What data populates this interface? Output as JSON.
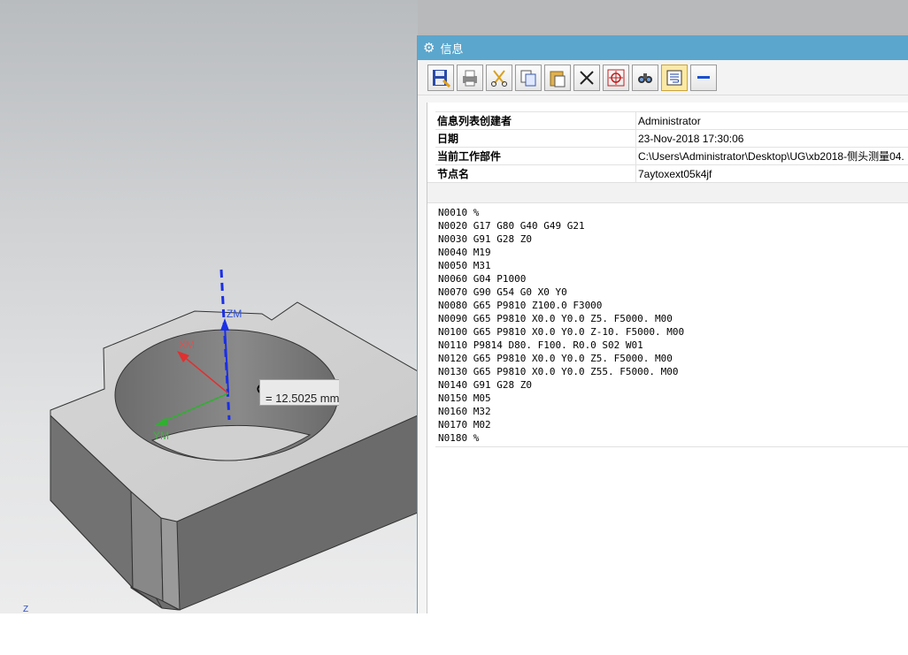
{
  "viewport": {
    "measurement": "= 12.5025 mm",
    "axes": {
      "z": "ZM",
      "x": "XM",
      "y": "YM",
      "corner": "Z"
    }
  },
  "window": {
    "title": "信息",
    "toolbar": [
      {
        "name": "save-icon"
      },
      {
        "name": "print-icon"
      },
      {
        "name": "cut-icon"
      },
      {
        "name": "copy-icon"
      },
      {
        "name": "paste-icon"
      },
      {
        "name": "delete-icon"
      },
      {
        "name": "target-icon"
      },
      {
        "name": "find-icon"
      },
      {
        "name": "word-wrap-icon",
        "active": true
      },
      {
        "name": "minimize-icon"
      }
    ],
    "header": [
      {
        "key": "信息列表创建者",
        "value": "Administrator"
      },
      {
        "key": "日期",
        "value": "23-Nov-2018 17:30:06"
      },
      {
        "key": "当前工作部件",
        "value": "C:\\Users\\Administrator\\Desktop\\UG\\xb2018-侧头测量04."
      },
      {
        "key": "节点名",
        "value": "7aytoxext05k4jf"
      }
    ],
    "gcode": [
      "N0010 %",
      "N0020 G17 G80 G40 G49 G21",
      "N0030 G91 G28 Z0",
      "N0040 M19",
      "N0050 M31",
      "N0060 G04 P1000",
      "N0070 G90 G54 G0 X0 Y0",
      "N0080 G65 P9810 Z100.0 F3000",
      "N0090 G65 P9810 X0.0 Y0.0 Z5. F5000. M00",
      "N0100 G65 P9810 X0.0 Y0.0 Z-10. F5000. M00",
      "N0110 P9814 D80. F100. R0.0 S02 W01",
      "N0120 G65 P9810 X0.0 Y0.0 Z5. F5000. M00",
      "N0130 G65 P9810 X0.0 Y0.0 Z55. F5000. M00",
      "N0140 G91 G28 Z0",
      "N0150 M05",
      "N0160 M32",
      "N0170 M02",
      "N0180 %"
    ]
  }
}
